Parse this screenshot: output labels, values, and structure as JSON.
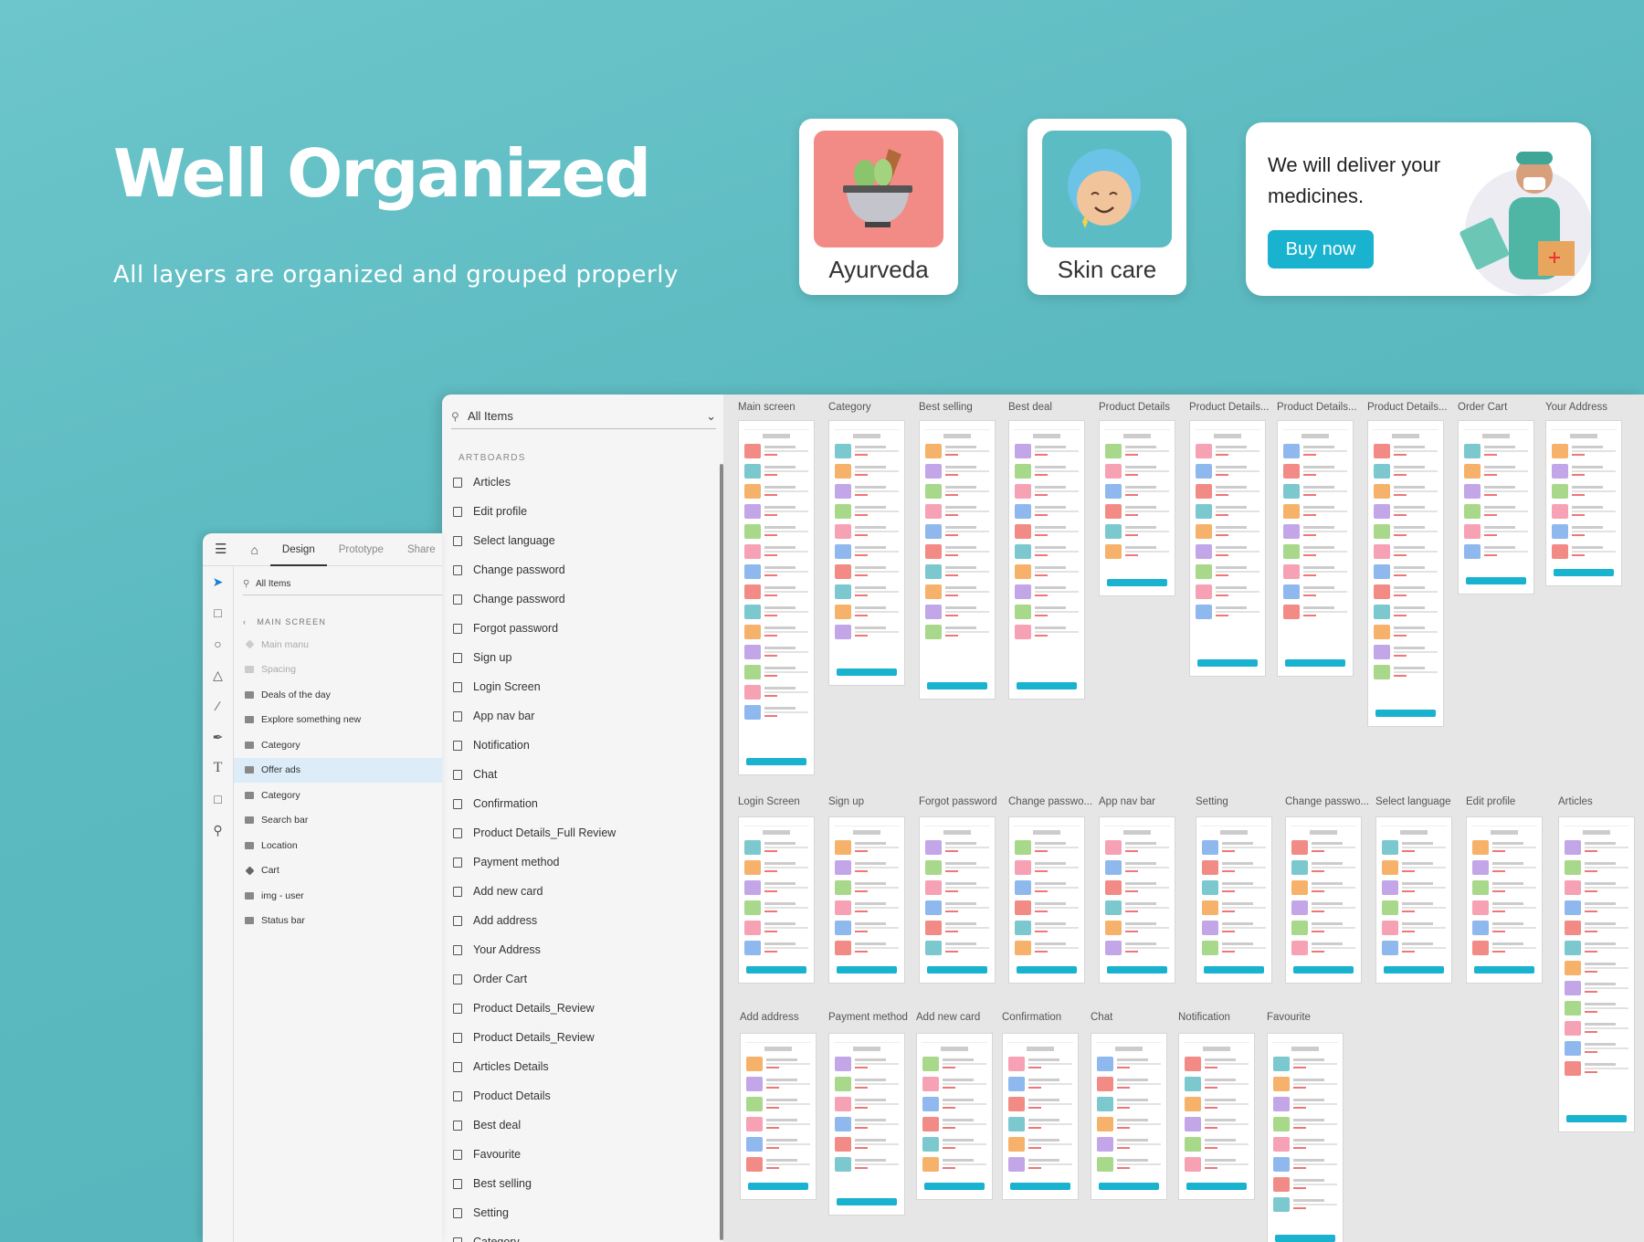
{
  "hero": {
    "title": "Well Organized",
    "subtitle": "All layers are organized and grouped properly"
  },
  "cards": [
    {
      "label": "Ayurveda",
      "color": "#f28b85",
      "icon": "mortar-pestle-icon"
    },
    {
      "label": "Skin care",
      "color": "#5cbcc4",
      "icon": "face-icon"
    }
  ],
  "banner": {
    "text": "We will deliver your medicines.",
    "button": "Buy now",
    "accent": "#19b2cf"
  },
  "xd_panel": {
    "search_label": "All Items",
    "section": "ARTBOARDS",
    "artboards": [
      "Articles",
      "Edit profile",
      "Select language",
      "Change password",
      "Change password",
      "Forgot password",
      "Sign up",
      "Login Screen",
      "App nav bar",
      "Notification",
      "Chat",
      "Confirmation",
      "Product Details_Full Review",
      "Payment method",
      "Add new card",
      "Add address",
      "Your Address",
      "Order Cart",
      "Product Details_Review",
      "Product Details_Review",
      "Articles Details",
      "Product Details",
      "Best deal",
      "Favourite",
      "Best selling",
      "Setting",
      "Category"
    ]
  },
  "canvas": {
    "rows": [
      [
        "Main screen",
        "Category",
        "Best selling",
        "Best deal",
        "Product Details",
        "Product Details...",
        "Product Details...",
        "Product Details...",
        "Order Cart",
        "Your Address"
      ],
      [
        "Login Screen",
        "Sign up",
        "Forgot password",
        "Change passwo...",
        "App nav bar",
        "Setting",
        "Change passwo...",
        "Select language",
        "Edit profile",
        "Articles"
      ],
      [
        "Add address",
        "Payment method",
        "Add new card",
        "Confirmation",
        "Chat",
        "Notification",
        "Favourite"
      ]
    ]
  },
  "layers_panel": {
    "tabs": [
      "Design",
      "Prototype",
      "Share"
    ],
    "search_label": "All Items",
    "section": "MAIN SCREEN",
    "layers": [
      {
        "label": "Main manu",
        "type": "component",
        "dim": true
      },
      {
        "label": "Spacing",
        "type": "folder",
        "dim": true
      },
      {
        "label": "Deals of the day",
        "type": "folder"
      },
      {
        "label": "Explore something new",
        "type": "folder"
      },
      {
        "label": "Category",
        "type": "folder"
      },
      {
        "label": "Offer ads",
        "type": "folder",
        "selected": true
      },
      {
        "label": "Category",
        "type": "folder"
      },
      {
        "label": "Search bar",
        "type": "folder"
      },
      {
        "label": "Location",
        "type": "folder"
      },
      {
        "label": "Cart",
        "type": "component"
      },
      {
        "label": "img - user",
        "type": "folder"
      },
      {
        "label": "Status bar",
        "type": "folder"
      }
    ]
  }
}
